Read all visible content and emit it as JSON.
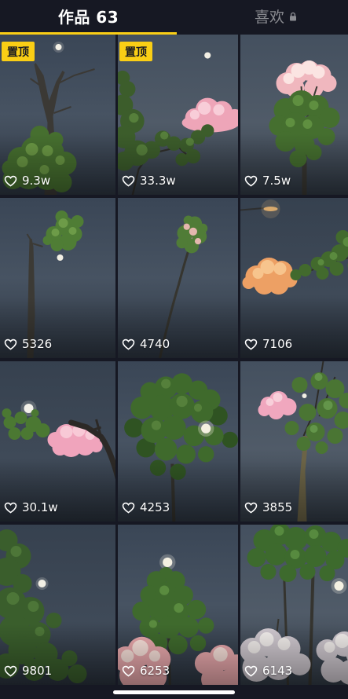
{
  "tabs": {
    "works": {
      "label": "作品 63",
      "active": true
    },
    "likes": {
      "label": "喜欢",
      "active": false,
      "icon": "lock-icon"
    }
  },
  "colors": {
    "accent": "#FACE15",
    "background": "#161823",
    "inactive_tab": "#8A8B91",
    "text": "#FFFFFF"
  },
  "like_icon": "heart-outline-icon",
  "videos": [
    {
      "likes": "9.3w",
      "pinned": true,
      "badge": "置顶"
    },
    {
      "likes": "33.3w",
      "pinned": true,
      "badge": "置顶"
    },
    {
      "likes": "7.5w",
      "pinned": false
    },
    {
      "likes": "5326",
      "pinned": false
    },
    {
      "likes": "4740",
      "pinned": false
    },
    {
      "likes": "7106",
      "pinned": false
    },
    {
      "likes": "30.1w",
      "pinned": false
    },
    {
      "likes": "4253",
      "pinned": false
    },
    {
      "likes": "3855",
      "pinned": false
    },
    {
      "likes": "9801",
      "pinned": false
    },
    {
      "likes": "6253",
      "pinned": false
    },
    {
      "likes": "6143",
      "pinned": false
    }
  ]
}
